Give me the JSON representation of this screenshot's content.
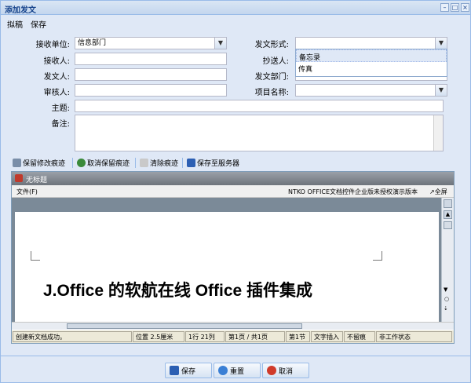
{
  "window": {
    "title": "添加发文"
  },
  "menu": {
    "draft": "拟稿",
    "save": "保存"
  },
  "form": {
    "receive_unit": {
      "label": "接收单位:",
      "value": "信息部门"
    },
    "receiver": {
      "label": "接收人:"
    },
    "sender": {
      "label": "发文人:"
    },
    "reviewer": {
      "label": "审核人:"
    },
    "subject": {
      "label": "主题:"
    },
    "remark": {
      "label": "备注:"
    },
    "doc_form": {
      "label": "发文形式:",
      "value": ""
    },
    "cc": {
      "label": "抄送人:"
    },
    "dept": {
      "label": "发文部门:"
    },
    "project": {
      "label": "项目名称:"
    }
  },
  "dropdown_options": [
    "备忘录",
    "传真"
  ],
  "edit_toolbar": {
    "keep_marks": "保留修改痕迹",
    "cancel_keep": "取消保留痕迹",
    "clear_marks": "清除痕迹",
    "save_server": "保存至服务器"
  },
  "office": {
    "doc_name": "无标题",
    "file_menu": "文件(F)",
    "license_text": "NTKO OFFICE文档控件企业版未授权演示版本",
    "fullscreen": "↗全屏",
    "content": "J.Office 的软航在线 Office 插件集成",
    "status": {
      "msg": "创建新文档成功。",
      "pos": "位置 2.5厘米",
      "line": "1行 21列",
      "page": "第1页 / 共1页",
      "section": "第1节",
      "insert": "文字插入",
      "track": "不留痕",
      "state": "非工作状态"
    }
  },
  "footer": {
    "save": "保存",
    "reset": "重置",
    "cancel": "取消"
  },
  "colors": {
    "accent": "#15428b",
    "border": "#99bbe8"
  }
}
